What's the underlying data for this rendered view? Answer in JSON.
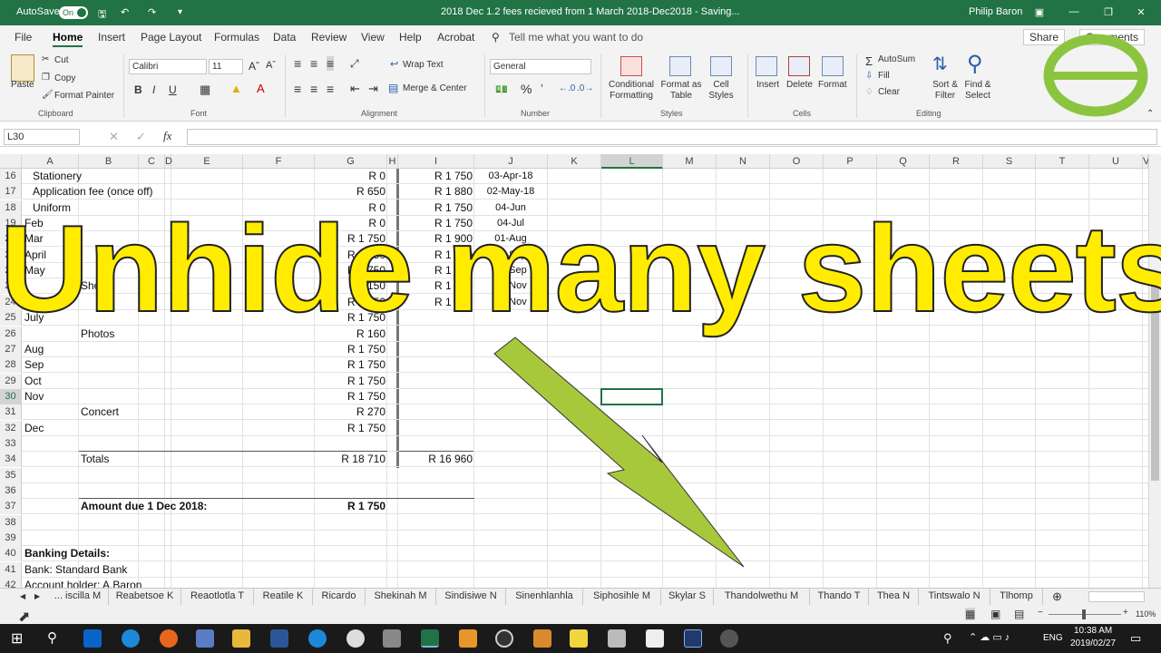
{
  "titlebar": {
    "autosave": "AutoSave",
    "toggle": "On",
    "doc_title": "2018 Dec 1.2 fees recieved from 1 March 2018-Dec2018  -  Saving...",
    "user": "Philip Baron"
  },
  "menu": [
    "File",
    "Home",
    "Insert",
    "Page Layout",
    "Formulas",
    "Data",
    "Review",
    "View",
    "Help",
    "Acrobat"
  ],
  "menu_active": "Home",
  "tell_me": "Tell me what you want to do",
  "share": "Share",
  "comments": "Comments",
  "ribbon": {
    "clipboard": {
      "paste": "Paste",
      "cut": "Cut",
      "copy": "Copy",
      "format_painter": "Format Painter",
      "group": "Clipboard"
    },
    "font": {
      "name": "Calibri",
      "size": "11",
      "group": "Font",
      "bold": "B",
      "italic": "I",
      "underline": "U"
    },
    "alignment": {
      "wrap": "Wrap Text",
      "merge": "Merge & Center",
      "group": "Alignment"
    },
    "number": {
      "format": "General",
      "group": "Number"
    },
    "styles": {
      "conditional": "Conditional Formatting",
      "format_table": "Format as Table",
      "cell_styles": "Cell Styles",
      "group": "Styles"
    },
    "cells": {
      "insert": "Insert",
      "delete": "Delete",
      "format": "Format",
      "group": "Cells"
    },
    "editing": {
      "autosum": "AutoSum",
      "fill": "Fill",
      "clear": "Clear",
      "sort": "Sort & Filter",
      "find": "Find & Select",
      "group": "Editing"
    }
  },
  "namebox": "L30",
  "columns": [
    "A",
    "B",
    "C",
    "D",
    "E",
    "F",
    "G",
    "H",
    "I",
    "J",
    "K",
    "L",
    "M",
    "N",
    "O",
    "P",
    "Q",
    "R",
    "S",
    "T",
    "U",
    "V"
  ],
  "selected_column": "L",
  "selected_row": "30",
  "rows": [
    {
      "n": "16",
      "a": "Stationery",
      "a_indent": true,
      "g": "R 0",
      "i": "R 1 750",
      "j": "03-Apr-18"
    },
    {
      "n": "17",
      "a": "Application fee (once off)",
      "a_indent": true,
      "g": "R 650",
      "i": "R 1 880",
      "j": "02-May-18"
    },
    {
      "n": "18",
      "a": "Uniform",
      "a_indent": true,
      "g": "R 0",
      "i": "R 1 750",
      "j": "04-Jun"
    },
    {
      "n": "19",
      "a": "Feb",
      "g": "R 0",
      "i": "R 1 750",
      "j": "04-Jul"
    },
    {
      "n": "20",
      "a": "Mar",
      "g": "R 1 750",
      "i": "R 1 900",
      "j": "01-Aug"
    },
    {
      "n": "21",
      "a": "April",
      "g": "R 1 750",
      "i": "R 1 750",
      "j": "03-Sep"
    },
    {
      "n": "22",
      "a": "May",
      "g": "R 1 750",
      "i": "R 1 750",
      "j": "28-Sep"
    },
    {
      "n": "23",
      "b": "Shoes",
      "g": "R 150",
      "i": "R 1 800",
      "j": "05-Nov"
    },
    {
      "n": "24",
      "a": "June",
      "g": "R 1 750",
      "i": "R 1 750",
      "j": "29-Nov"
    },
    {
      "n": "25",
      "a": "July",
      "g": "R 1 750"
    },
    {
      "n": "26",
      "b": "Photos",
      "g": "R 160"
    },
    {
      "n": "27",
      "a": "Aug",
      "g": "R 1 750"
    },
    {
      "n": "28",
      "a": "Sep",
      "g": "R 1 750"
    },
    {
      "n": "29",
      "a": "Oct",
      "g": "R 1 750"
    },
    {
      "n": "30",
      "a": "Nov",
      "g": "R 1 750"
    },
    {
      "n": "31",
      "b": "Concert",
      "g": "R 270"
    },
    {
      "n": "32",
      "a": "Dec",
      "g": "R 1 750"
    },
    {
      "n": "33"
    },
    {
      "n": "34",
      "b": "Totals",
      "g": "R 18 710",
      "i": "R 16 960"
    },
    {
      "n": "35"
    },
    {
      "n": "36"
    },
    {
      "n": "37",
      "b": "Amount due 1 Dec  2018:",
      "b_bold": true,
      "g": "R 1 750",
      "g_bold": true
    },
    {
      "n": "38"
    },
    {
      "n": "39"
    },
    {
      "n": "40",
      "a": "Banking Details:",
      "a_bold": true
    },
    {
      "n": "41",
      "a": "Bank: Standard Bank"
    },
    {
      "n": "42",
      "a": "Account holder: A.Baron"
    }
  ],
  "sheet_tabs": [
    "... iscilla M",
    "Reabetsoe K",
    "Reaotlotla T",
    "Reatile K",
    "Ricardo",
    "Shekinah M",
    "Sindisiwe N",
    "Sinenhlanhla",
    "Siphosihle M",
    "Skylar S",
    "Thandolwethu M",
    "Thando T",
    "Thea N",
    "Tintswalo N",
    "Tlhomp"
  ],
  "status": {
    "zoom": "110%"
  },
  "taskbar": {
    "lang": "ENG",
    "time": "10:38 AM",
    "date": "2019/02/27"
  },
  "overlay": {
    "text": "Unhide many sheets",
    "color": "#ffec00",
    "arrow_color": "#a8c83c"
  },
  "icons": [
    "windows-icon",
    "search-icon",
    "outlook-icon",
    "edge-icon",
    "firefox-icon",
    "word-icon",
    "ie-icon",
    "chrome-icon",
    "excel-icon"
  ]
}
